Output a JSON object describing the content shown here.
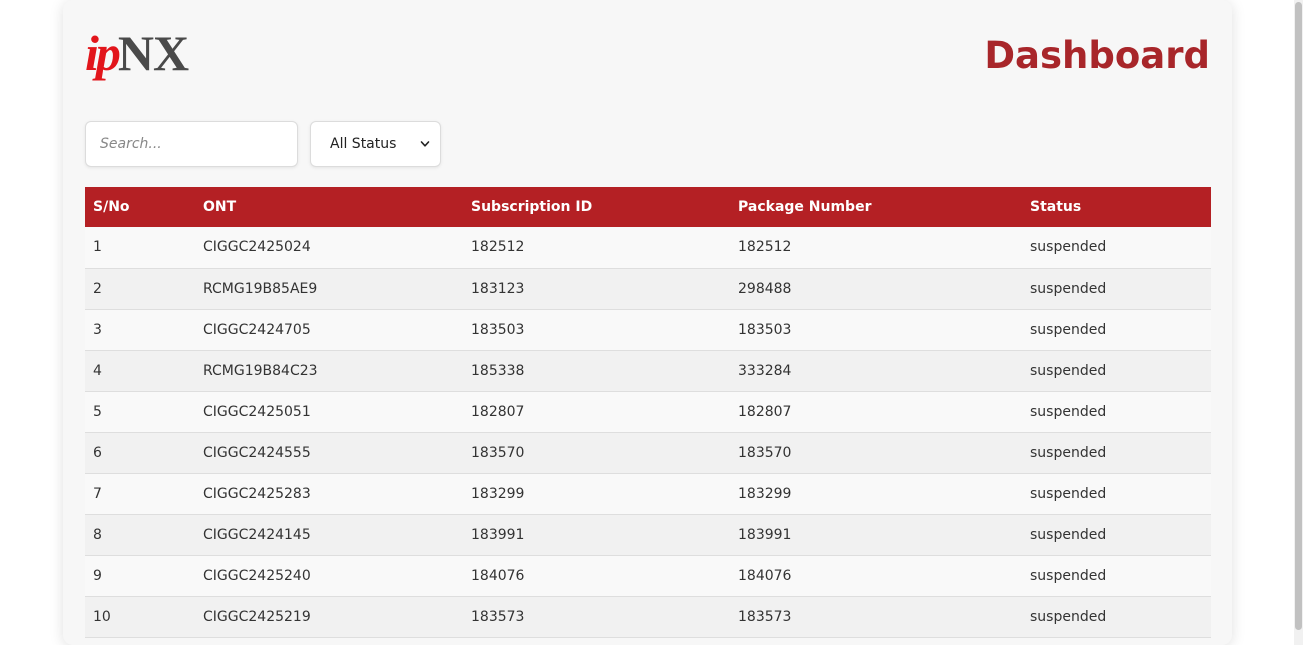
{
  "logo": {
    "part1": "ip",
    "part2": "NX"
  },
  "header": {
    "title": "Dashboard"
  },
  "filters": {
    "search_placeholder": "Search...",
    "status_selected": "All Status"
  },
  "table": {
    "columns": [
      "S/No",
      "ONT",
      "Subscription ID",
      "Package Number",
      "Status"
    ],
    "rows": [
      [
        "1",
        "CIGGC2425024",
        "182512",
        "182512",
        "suspended"
      ],
      [
        "2",
        "RCMG19B85AE9",
        "183123",
        "298488",
        "suspended"
      ],
      [
        "3",
        "CIGGC2424705",
        "183503",
        "183503",
        "suspended"
      ],
      [
        "4",
        "RCMG19B84C23",
        "185338",
        "333284",
        "suspended"
      ],
      [
        "5",
        "CIGGC2425051",
        "182807",
        "182807",
        "suspended"
      ],
      [
        "6",
        "CIGGC2424555",
        "183570",
        "183570",
        "suspended"
      ],
      [
        "7",
        "CIGGC2425283",
        "183299",
        "183299",
        "suspended"
      ],
      [
        "8",
        "CIGGC2424145",
        "183991",
        "183991",
        "suspended"
      ],
      [
        "9",
        "CIGGC2425240",
        "184076",
        "184076",
        "suspended"
      ],
      [
        "10",
        "CIGGC2425219",
        "183573",
        "183573",
        "suspended"
      ]
    ]
  },
  "colors": {
    "brand_red": "#b42024",
    "title_red": "#a8262a",
    "logo_red": "#e2151b",
    "logo_gray": "#4a4a4a"
  }
}
